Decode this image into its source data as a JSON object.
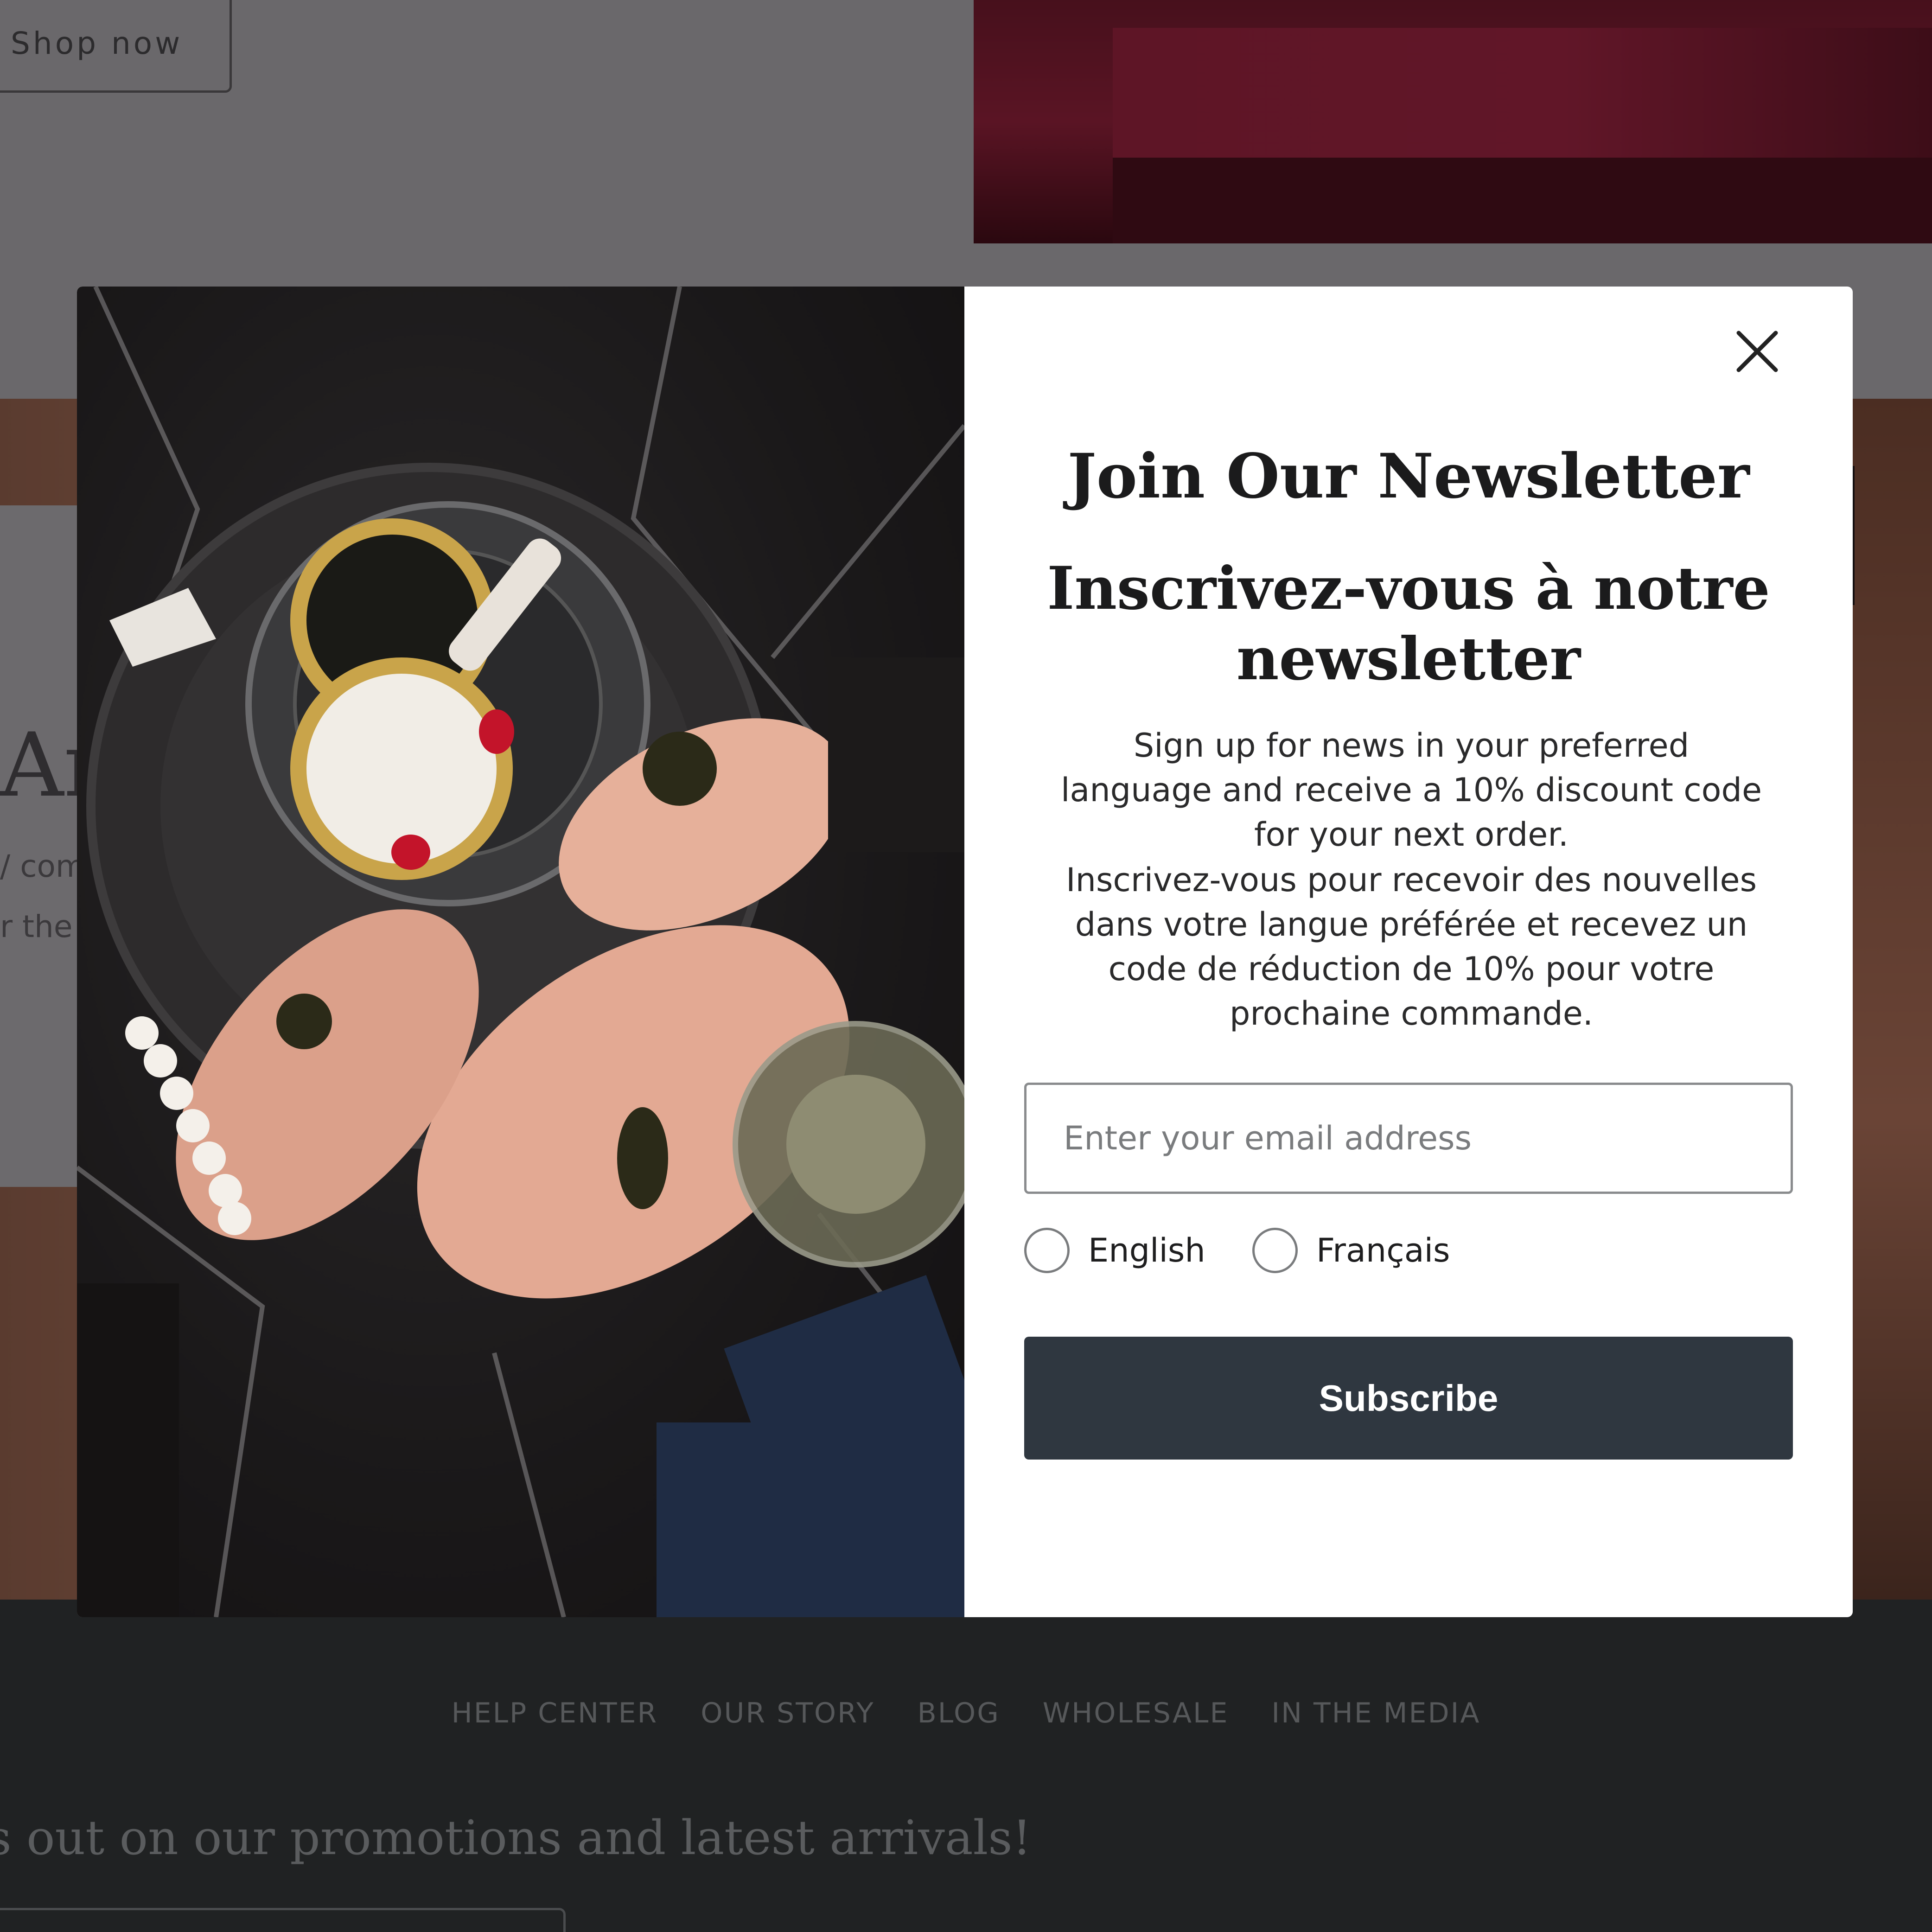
{
  "background": {
    "shop_now_label": "Shop now",
    "title_fragment": "Ar",
    "text_fragment_1": "/ com",
    "text_fragment_2": "r the"
  },
  "footer": {
    "nav": [
      "HELP CENTER",
      "OUR STORY",
      "BLOG",
      "WHOLESALE",
      "IN THE MEDIA"
    ],
    "promo_text": "ss out on our promotions and latest arrivals!"
  },
  "modal": {
    "image_alt": "Hands holding caviar above a tin on a black marble table",
    "title_en": "Join Our Newsletter",
    "title_fr": "Inscrivez-vous à notre newsletter",
    "description_en": "Sign up for news in your preferred language and receive a 10% discount code for your next order.",
    "description_fr": "Inscrivez-vous pour recevoir des nouvelles dans votre langue préférée et recevez un code de réduction de 10% pour votre prochaine commande.",
    "email_placeholder": "Enter your email address",
    "email_value": "",
    "language_options": [
      "English",
      "Français"
    ],
    "subscribe_label": "Subscribe",
    "close_icon": "close-icon"
  },
  "colors": {
    "button_bg": "#2f3740",
    "overlay": "#6a686b",
    "footer_bg": "#202223"
  }
}
